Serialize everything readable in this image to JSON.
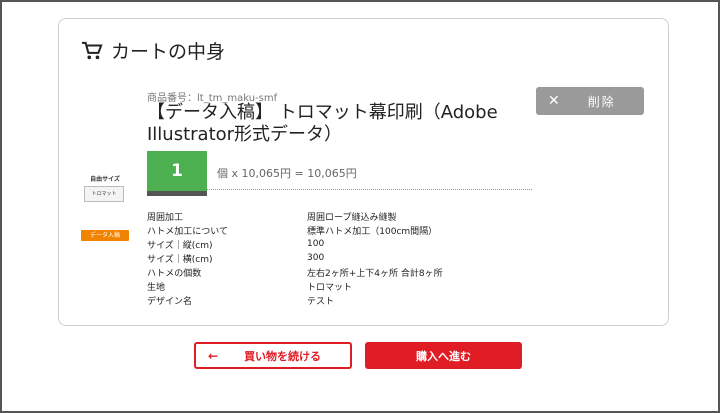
{
  "cart": {
    "title": "カートの中身",
    "icon": "cart-icon"
  },
  "item": {
    "code": "商品番号：lt_tm_maku-smf",
    "name": "【データ入稿】 トロマット幕印刷（Adobe Illustrator形式データ）",
    "delete_label": "削除",
    "thumbnail_label": "自由サイズ",
    "thumbnail_text": "トロマット",
    "badge": "データ入稿",
    "quantity": "1",
    "price_line": "個 x 10,065円 = 10,065円",
    "specs": [
      {
        "key": "周囲加工",
        "value": "周囲ロープ縫込み縫製"
      },
      {
        "key": "ハトメ加工について",
        "value": "標準ハトメ加工（100cm間隔）"
      },
      {
        "key": "サイズ｜縦(cm)",
        "value": "100"
      },
      {
        "key": "サイズ｜横(cm)",
        "value": "300"
      },
      {
        "key": "ハトメの個数",
        "value": "左右2ヶ所+上下4ヶ所 合計8ヶ所"
      },
      {
        "key": "生地",
        "value": "トロマット"
      },
      {
        "key": "デザイン名",
        "value": "テスト"
      }
    ]
  },
  "actions": {
    "continue_label": "買い物を続ける",
    "checkout_label": "購入へ進む"
  },
  "colors": {
    "accent": "#e01c24",
    "quantity_bg": "#4caf50",
    "delete_bg": "#9a9a9a",
    "badge_bg": "#f08300"
  }
}
